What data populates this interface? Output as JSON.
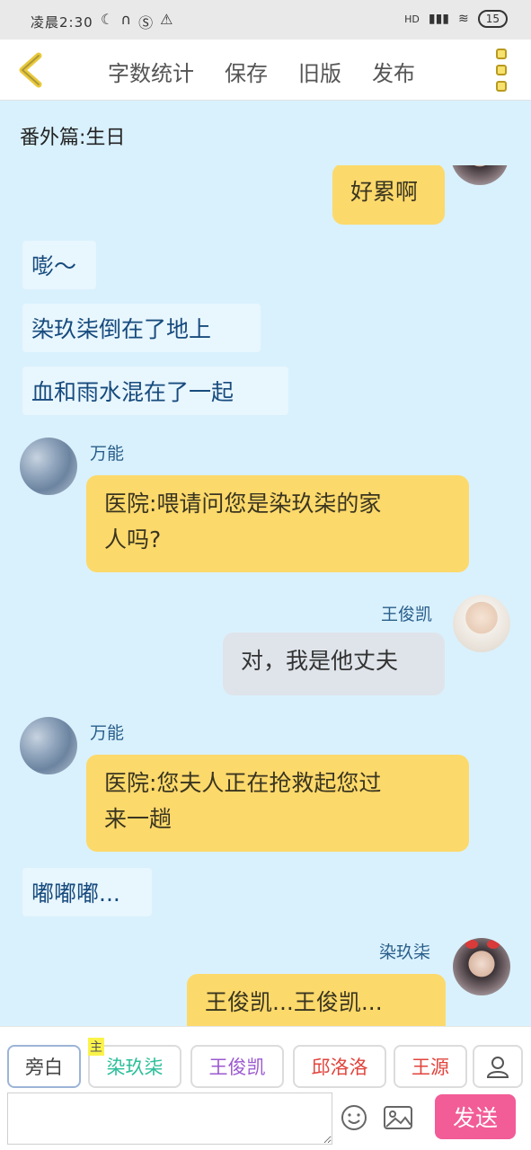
{
  "status_bar": {
    "time": "凌晨2:30",
    "left_icons": [
      "moon-icon",
      "headset-icon",
      "s-icon",
      "warning-icon"
    ],
    "network": "HD",
    "battery": "15"
  },
  "toolbar": {
    "actions": [
      "字数统计",
      "保存",
      "旧版",
      "发布"
    ]
  },
  "title": "番外篇:生日",
  "messages": [
    {
      "type": "right",
      "text": "好累啊",
      "avatar": "portrait-f"
    },
    {
      "type": "narr",
      "text": "嘭～"
    },
    {
      "type": "narr",
      "text": "染玖柒倒在了地上"
    },
    {
      "type": "narr",
      "text": "血和雨水混在了一起"
    },
    {
      "type": "left",
      "name": "万能",
      "text_lines": [
        "医院:喂请问您是染玖柒的家",
        "人吗?"
      ]
    },
    {
      "type": "right",
      "name": "王俊凯",
      "text": "对，我是他丈夫"
    },
    {
      "type": "left",
      "name": "万能",
      "text_lines": [
        "医院:您夫人正在抢救起您过",
        "来一趟"
      ]
    },
    {
      "type": "narr",
      "text": "嘟嘟嘟..."
    },
    {
      "type": "right",
      "name": "染玖柒",
      "text": "王俊凯...王俊凯..."
    }
  ],
  "role_bar": {
    "main_tag": "主",
    "roles": [
      {
        "label": "旁白",
        "color": "#444444"
      },
      {
        "label": "染玖柒",
        "color": "#2bbf9a"
      },
      {
        "label": "王俊凯",
        "color": "#9b59d0"
      },
      {
        "label": "邱洛洛",
        "color": "#e0443c"
      },
      {
        "label": "王源",
        "color": "#e0443c"
      }
    ]
  },
  "input": {
    "placeholder": "",
    "send_label": "发送"
  }
}
